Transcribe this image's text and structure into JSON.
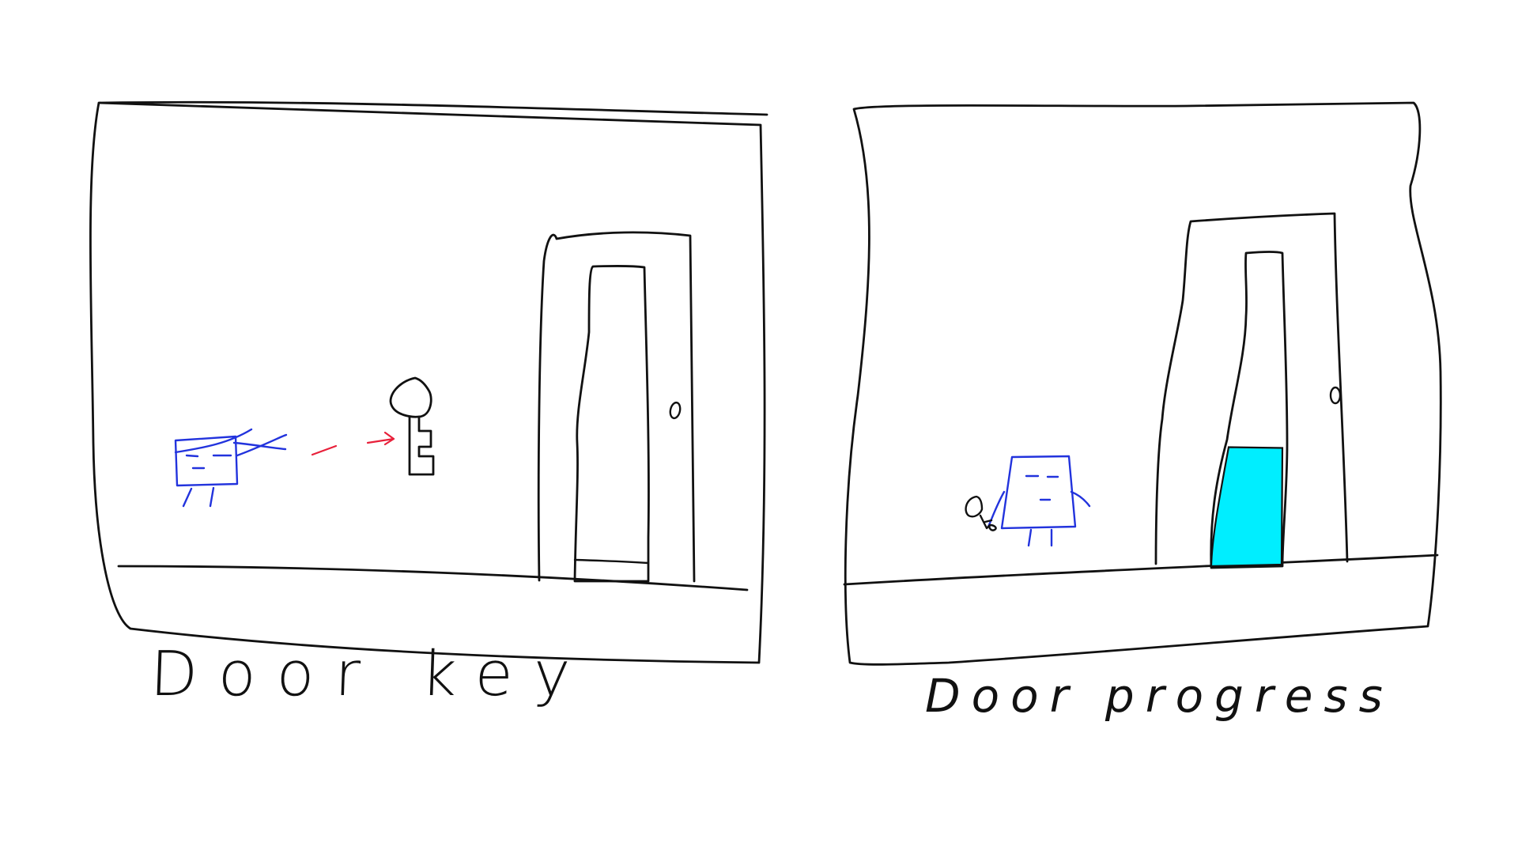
{
  "panels": [
    {
      "caption": "Door key",
      "colors": {
        "ink": "#111111",
        "agent": "#2233dd",
        "arrow": "#e8203a"
      }
    },
    {
      "caption": "Door progress",
      "progress": 0.38,
      "colors": {
        "ink": "#111111",
        "agent": "#2233dd",
        "progress_fill": "#00eeff"
      }
    }
  ]
}
